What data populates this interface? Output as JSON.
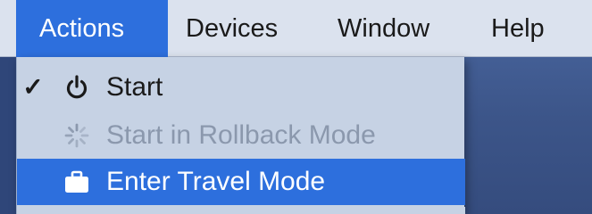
{
  "menubar": {
    "items": [
      {
        "label": "Actions",
        "active": true
      },
      {
        "label": "Devices",
        "active": false
      },
      {
        "label": "Window",
        "active": false
      },
      {
        "label": "Help",
        "active": false
      }
    ]
  },
  "actions_menu": {
    "items": [
      {
        "label": "Start",
        "checked": true,
        "enabled": true,
        "highlighted": false,
        "icon": "power-icon"
      },
      {
        "label": "Start in Rollback Mode",
        "checked": false,
        "enabled": false,
        "highlighted": false,
        "icon": "spinner-icon"
      },
      {
        "label": "Enter Travel Mode",
        "checked": false,
        "enabled": true,
        "highlighted": true,
        "icon": "briefcase-icon"
      }
    ],
    "check_glyph": "✓"
  },
  "colors": {
    "highlight": "#2d6fdd",
    "menubar_bg": "#dbe2ee",
    "menu_bg": "#c6d2e4",
    "disabled_text": "#8b98ad",
    "desktop": "#3f5a8d"
  }
}
